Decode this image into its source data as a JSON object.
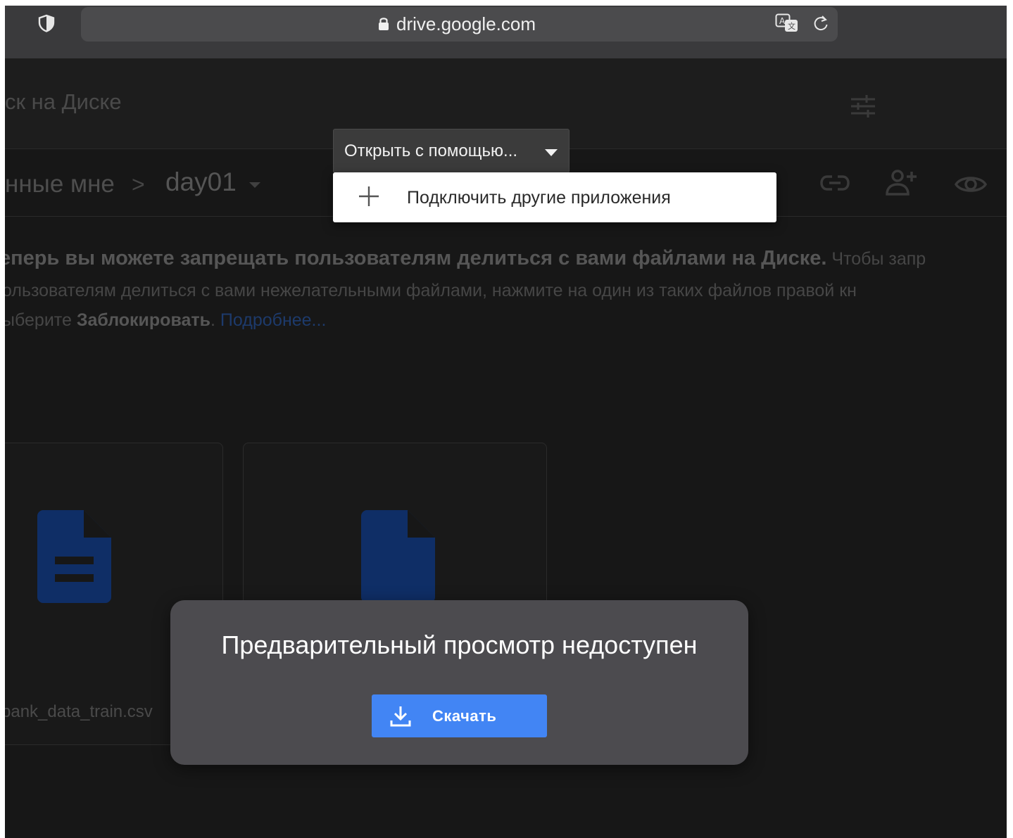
{
  "browser": {
    "url": "drive.google.com",
    "icons": [
      "shield-icon",
      "lock-icon",
      "translate-icon",
      "reload-icon"
    ]
  },
  "header": {
    "search_placeholder": "ск на Диске",
    "filter_icon": "tune-icon"
  },
  "breadcrumb": {
    "shared": "нные мне",
    "separator": ">",
    "current": "day01"
  },
  "toolbar_icons": [
    "link-icon",
    "add-person-icon",
    "eye-icon"
  ],
  "notice": {
    "bold_lead": "еперь вы можете запрещать пользователям делиться с вами файлами на Диске.",
    "rest_line1": " Чтобы запр",
    "line2": "ользователям делиться с вами нежелательными файлами, нажмите на один из таких файлов правой кн",
    "line3_prefix": "ыберите ",
    "line3_bold": "Заблокировать",
    "line3_dot": ". ",
    "more_link": "Подробнее..."
  },
  "files": [
    {
      "name": "bank_data_train.csv",
      "icon": "document-icon"
    },
    {
      "name": "",
      "icon": "document-icon"
    }
  ],
  "open_with": {
    "label": "Открыть с помощью...",
    "menu_item": "Подключить другие приложения"
  },
  "dialog": {
    "title": "Предварительный просмотр недоступен",
    "download_label": "Скачать"
  },
  "colors": {
    "accent": "#4285f4",
    "doc_icon": "#0f2e66",
    "dialog_bg": "#4c4b4f"
  }
}
